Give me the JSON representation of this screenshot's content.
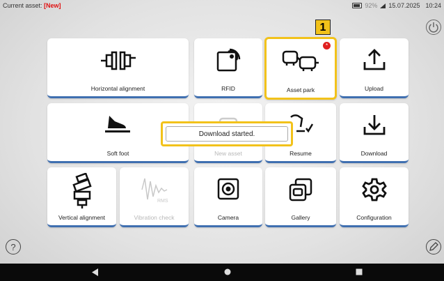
{
  "status": {
    "asset_prefix": "Current asset:",
    "asset_value": "[New]",
    "battery": "92%",
    "date": "15.07.2025",
    "time": "10:24"
  },
  "tiles": {
    "horizontal_alignment": "Horizontal alignment",
    "rfid": "RFID",
    "asset_park": "Asset park",
    "upload": "Upload",
    "soft_foot": "Soft foot",
    "new_asset": "New asset",
    "resume": "Resume",
    "download": "Download",
    "vertical_alignment": "Vertical alignment",
    "vibration_check": "Vibration check",
    "camera": "Camera",
    "gallery": "Gallery",
    "configuration": "Configuration"
  },
  "asset_park_badge": "*",
  "callout_number": "1",
  "toast": "Download started.",
  "help": "?"
}
